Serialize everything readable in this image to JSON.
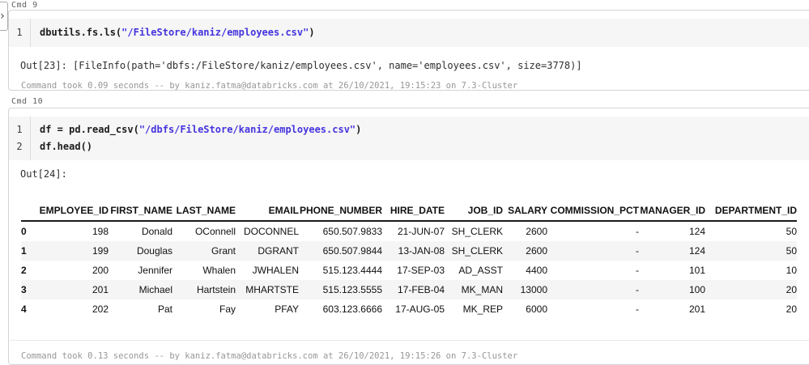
{
  "colors": {
    "string_token": "#4434dd",
    "code_background": "#f6f6f6",
    "row_stripe": "#f5f5f5",
    "cell_border": "#d4d4d4"
  },
  "nav_toggle": {
    "icon": "chevron-right-icon",
    "glyph": "›"
  },
  "cmd9": {
    "label": "Cmd 9",
    "code_lines": [
      {
        "num": "1",
        "prefix": "dbutils.fs.ls(",
        "string": "\"/FileStore/kaniz/employees.csv\"",
        "suffix": ")"
      }
    ],
    "output": "Out[23]: [FileInfo(path='dbfs:/FileStore/kaniz/employees.csv', name='employees.csv', size=3778)]",
    "footer": "Command took 0.09 seconds -- by kaniz.fatma@databricks.com at 26/10/2021, 19:15:23 on 7.3-Cluster"
  },
  "cmd10": {
    "label": "Cmd 10",
    "code_lines": [
      {
        "num": "1",
        "prefix": "df = pd.read_csv(",
        "string": "\"/dbfs/FileStore/kaniz/employees.csv\"",
        "suffix": ")"
      },
      {
        "num": "2",
        "prefix": "df.head()",
        "string": "",
        "suffix": ""
      }
    ],
    "out_label": "Out[24]:",
    "table": {
      "headers": [
        "",
        "EMPLOYEE_ID",
        "FIRST_NAME",
        "LAST_NAME",
        "EMAIL",
        "PHONE_NUMBER",
        "HIRE_DATE",
        "JOB_ID",
        "SALARY",
        "COMMISSION_PCT",
        "MANAGER_ID",
        "DEPARTMENT_ID"
      ],
      "rows": [
        [
          "0",
          "198",
          "Donald",
          "OConnell",
          "DOCONNEL",
          "650.507.9833",
          "21-JUN-07",
          "SH_CLERK",
          "2600",
          "-",
          "124",
          "50"
        ],
        [
          "1",
          "199",
          "Douglas",
          "Grant",
          "DGRANT",
          "650.507.9844",
          "13-JAN-08",
          "SH_CLERK",
          "2600",
          "-",
          "124",
          "50"
        ],
        [
          "2",
          "200",
          "Jennifer",
          "Whalen",
          "JWHALEN",
          "515.123.4444",
          "17-SEP-03",
          "AD_ASST",
          "4400",
          "-",
          "101",
          "10"
        ],
        [
          "3",
          "201",
          "Michael",
          "Hartstein",
          "MHARTSTE",
          "515.123.5555",
          "17-FEB-04",
          "MK_MAN",
          "13000",
          "-",
          "100",
          "20"
        ],
        [
          "4",
          "202",
          "Pat",
          "Fay",
          "PFAY",
          "603.123.6666",
          "17-AUG-05",
          "MK_REP",
          "6000",
          "-",
          "201",
          "20"
        ]
      ]
    },
    "footer": "Command took 0.13 seconds -- by kaniz.fatma@databricks.com at 26/10/2021, 19:15:26 on 7.3-Cluster"
  }
}
